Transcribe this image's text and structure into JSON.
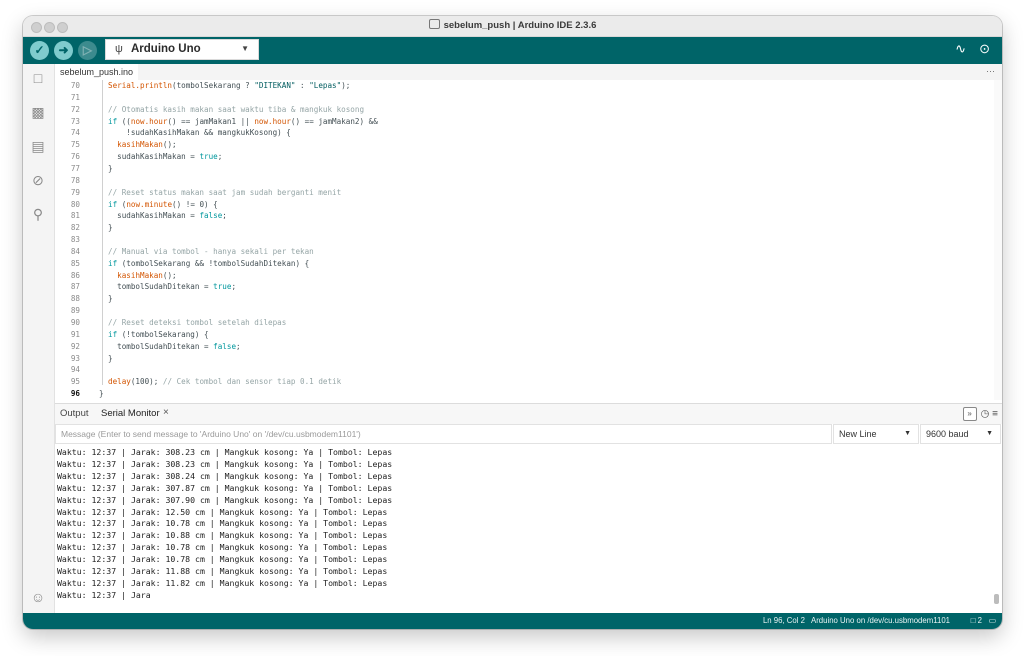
{
  "window": {
    "title": "sebelum_push | Arduino IDE 2.3.6"
  },
  "toolbar": {
    "verify_icon": "check-icon",
    "upload_icon": "arrow-right-icon",
    "debug_icon": "debug-icon",
    "board_name": "Arduino Uno",
    "accent_color": "#006468"
  },
  "editor": {
    "file_tab": "sebelum_push.ino",
    "more_label": "···",
    "lines": [
      {
        "no": "70",
        "text": "Serial.println(tombolSekarang ? \"DITEKAN\" : \"Lepas\");",
        "indent": 1
      },
      {
        "no": "71",
        "text": "",
        "indent": 1
      },
      {
        "no": "72",
        "text": "// Otomatis kasih makan saat waktu tiba & mangkuk kosong",
        "indent": 1,
        "kind": "comment"
      },
      {
        "no": "73",
        "text": "if ((now.hour() == jamMakan1 || now.hour() == jamMakan2) &&",
        "indent": 1
      },
      {
        "no": "74",
        "text": "    !sudahKasihMakan && mangkukKosong) {",
        "indent": 1
      },
      {
        "no": "75",
        "text": "  kasihMakan();",
        "indent": 1
      },
      {
        "no": "76",
        "text": "  sudahKasihMakan = true;",
        "indent": 1
      },
      {
        "no": "77",
        "text": "}",
        "indent": 1
      },
      {
        "no": "78",
        "text": "",
        "indent": 1
      },
      {
        "no": "79",
        "text": "// Reset status makan saat jam sudah berganti menit",
        "indent": 1,
        "kind": "comment"
      },
      {
        "no": "80",
        "text": "if (now.minute() != 0) {",
        "indent": 1
      },
      {
        "no": "81",
        "text": "  sudahKasihMakan = false;",
        "indent": 1
      },
      {
        "no": "82",
        "text": "}",
        "indent": 1
      },
      {
        "no": "83",
        "text": "",
        "indent": 1
      },
      {
        "no": "84",
        "text": "// Manual via tombol - hanya sekali per tekan",
        "indent": 1,
        "kind": "comment"
      },
      {
        "no": "85",
        "text": "if (tombolSekarang && !tombolSudahDitekan) {",
        "indent": 1
      },
      {
        "no": "86",
        "text": "  kasihMakan();",
        "indent": 1
      },
      {
        "no": "87",
        "text": "  tombolSudahDitekan = true;",
        "indent": 1
      },
      {
        "no": "88",
        "text": "}",
        "indent": 1
      },
      {
        "no": "89",
        "text": "",
        "indent": 1
      },
      {
        "no": "90",
        "text": "// Reset deteksi tombol setelah dilepas",
        "indent": 1,
        "kind": "comment"
      },
      {
        "no": "91",
        "text": "if (!tombolSekarang) {",
        "indent": 1
      },
      {
        "no": "92",
        "text": "  tombolSudahDitekan = false;",
        "indent": 1
      },
      {
        "no": "93",
        "text": "}",
        "indent": 1
      },
      {
        "no": "94",
        "text": "",
        "indent": 1
      },
      {
        "no": "95",
        "text": "delay(100); // Cek tombol dan sensor tiap 0.1 detik",
        "indent": 1
      },
      {
        "no": "96",
        "text": "}",
        "indent": 0,
        "current": true
      }
    ]
  },
  "panel": {
    "tab_output": "Output",
    "tab_serial": "Serial Monitor",
    "close_glyph": "×",
    "message_placeholder": "Message (Enter to send message to 'Arduino Uno' on '/dev/cu.usbmodem1101')",
    "line_ending": "New Line",
    "baud_rate": "9600 baud",
    "serial_lines": [
      "Waktu: 12:37 | Jarak: 308.23 cm | Mangkuk kosong: Ya | Tombol: Lepas",
      "Waktu: 12:37 | Jarak: 308.23 cm | Mangkuk kosong: Ya | Tombol: Lepas",
      "Waktu: 12:37 | Jarak: 308.24 cm | Mangkuk kosong: Ya | Tombol: Lepas",
      "Waktu: 12:37 | Jarak: 307.87 cm | Mangkuk kosong: Ya | Tombol: Lepas",
      "Waktu: 12:37 | Jarak: 307.90 cm | Mangkuk kosong: Ya | Tombol: Lepas",
      "Waktu: 12:37 | Jarak: 12.50 cm | Mangkuk kosong: Ya | Tombol: Lepas",
      "Waktu: 12:37 | Jarak: 10.78 cm | Mangkuk kosong: Ya | Tombol: Lepas",
      "Waktu: 12:37 | Jarak: 10.88 cm | Mangkuk kosong: Ya | Tombol: Lepas",
      "Waktu: 12:37 | Jarak: 10.78 cm | Mangkuk kosong: Ya | Tombol: Lepas",
      "Waktu: 12:37 | Jarak: 10.78 cm | Mangkuk kosong: Ya | Tombol: Lepas",
      "Waktu: 12:37 | Jarak: 11.88 cm | Mangkuk kosong: Ya | Tombol: Lepas",
      "Waktu: 12:37 | Jarak: 11.82 cm | Mangkuk kosong: Ya | Tombol: Lepas",
      "Waktu: 12:37 | Jara"
    ]
  },
  "statusbar": {
    "cursor": "Ln 96, Col 2",
    "board_port": "Arduino Uno on /dev/cu.usbmodem1101",
    "notifications": "2"
  }
}
